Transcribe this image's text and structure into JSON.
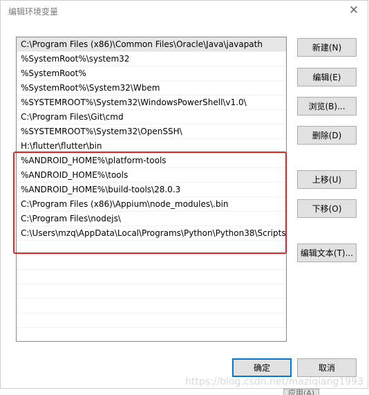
{
  "window": {
    "title": "编辑环境变量",
    "close_glyph": "✕"
  },
  "paths": [
    "C:\\Program Files (x86)\\Common Files\\Oracle\\Java\\javapath",
    "%SystemRoot%\\system32",
    "%SystemRoot%",
    "%SystemRoot%\\System32\\Wbem",
    "%SYSTEMROOT%\\System32\\WindowsPowerShell\\v1.0\\",
    "C:\\Program Files\\Git\\cmd",
    "%SYSTEMROOT%\\System32\\OpenSSH\\",
    "H:\\flutter\\flutter\\bin",
    "%ANDROID_HOME%\\platform-tools",
    "%ANDROID_HOME%\\tools",
    "%ANDROID_HOME%\\build-tools\\28.0.3",
    "C:\\Program Files (x86)\\Appium\\node_modules\\.bin",
    "C:\\Program Files\\nodejs\\",
    "C:\\Users\\mzq\\AppData\\Local\\Programs\\Python\\Python38\\Scripts"
  ],
  "buttons": {
    "new": "新建(N)",
    "edit": "编辑(E)",
    "browse": "浏览(B)...",
    "delete": "删除(D)",
    "move_up": "上移(U)",
    "move_down": "下移(O)",
    "edit_text": "编辑文本(T)...",
    "ok": "确定",
    "cancel": "取消"
  },
  "watermark": "https://blog.csdn.net/maziqiang1993",
  "background": {
    "apply_label": "应用(A)"
  },
  "colors": {
    "highlight_border": "#e02424",
    "selected_row": "#e6e6e6",
    "default_button_border": "#0078d7"
  }
}
